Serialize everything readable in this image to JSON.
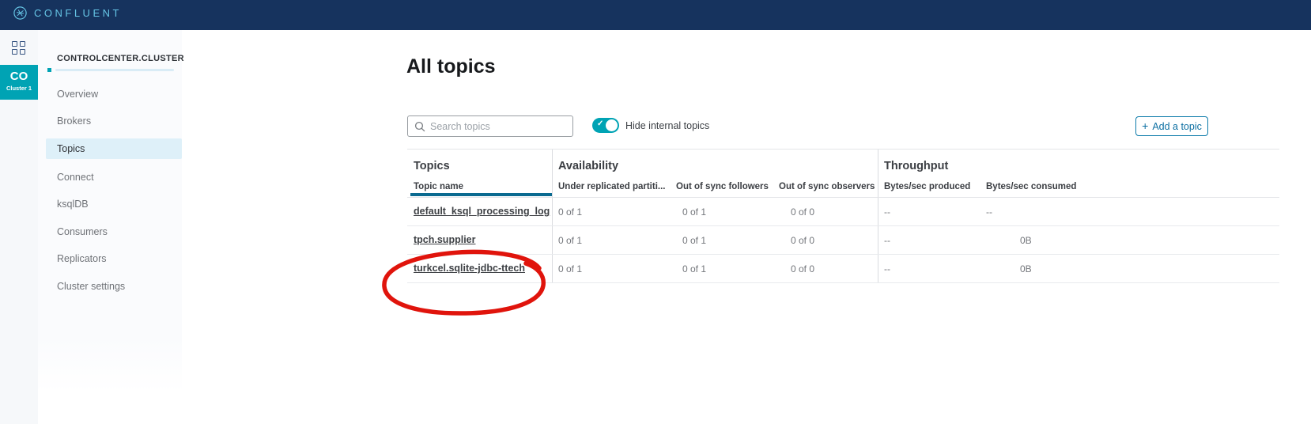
{
  "topbar": {
    "brand": "CONFLUENT"
  },
  "rail": {
    "cluster_initials": "CO",
    "cluster_label": "Cluster 1"
  },
  "sidebar": {
    "cluster_name": "CONTROLCENTER.CLUSTER",
    "items": [
      {
        "label": "Overview",
        "active": false
      },
      {
        "label": "Brokers",
        "active": false
      },
      {
        "label": "Topics",
        "active": true
      },
      {
        "label": "Connect",
        "active": false
      },
      {
        "label": "ksqlDB",
        "active": false
      },
      {
        "label": "Consumers",
        "active": false
      },
      {
        "label": "Replicators",
        "active": false
      },
      {
        "label": "Cluster settings",
        "active": false
      }
    ]
  },
  "main": {
    "title": "All topics",
    "search_placeholder": "Search topics",
    "toggle_label": "Hide internal topics",
    "toggle_state": "on",
    "add_button_plus": "+",
    "add_button_label": "Add a topic"
  },
  "table": {
    "groups": {
      "topics": "Topics",
      "availability": "Availability",
      "throughput": "Throughput"
    },
    "columns": {
      "topic_name": "Topic name",
      "under_replicated": "Under replicated partiti...",
      "oos_followers": "Out of sync followers",
      "oos_observers": "Out of sync observers",
      "bytes_produced": "Bytes/sec produced",
      "bytes_consumed": "Bytes/sec consumed"
    },
    "rows": [
      {
        "topic": "default_ksql_processing_log",
        "under_replicated": "0 of 1",
        "oos_followers": "0 of 1",
        "oos_observers": "0 of 0",
        "bytes_produced": "--",
        "bytes_consumed": "--"
      },
      {
        "topic": "tpch.supplier",
        "under_replicated": "0 of 1",
        "oos_followers": "0 of 1",
        "oos_observers": "0 of 0",
        "bytes_produced": "--",
        "bytes_consumed": "0B"
      },
      {
        "topic": "turkcel.sqlite-jdbc-ttech",
        "under_replicated": "0 of 1",
        "oos_followers": "0 of 1",
        "oos_observers": "0 of 0",
        "bytes_produced": "--",
        "bytes_consumed": "0B"
      }
    ],
    "annotation": {
      "type": "hand-drawn-red-circle",
      "target_row": "turkcel.sqlite-jdbc-ttech",
      "color": "#e0140c"
    }
  },
  "colors": {
    "topbar_navy": "#16335e",
    "brand_blue": "#66c5e5",
    "teal": "#00a3b4",
    "active_item_bg": "#def0f9",
    "sorted_underline": "#0a6a90",
    "button_blue": "#0e7cab",
    "annotation_red": "#e0140c"
  }
}
